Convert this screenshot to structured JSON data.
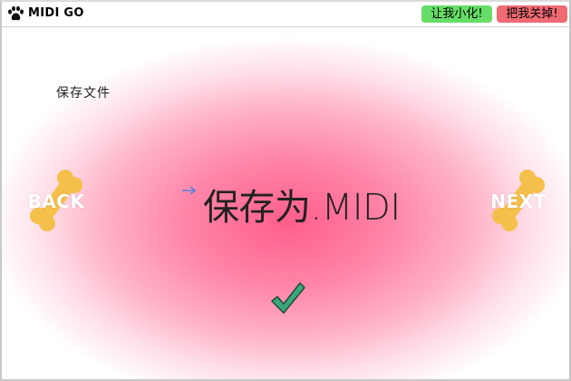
{
  "window": {
    "title": "MIDI GO",
    "minimize_label": "让我小化!",
    "close_label": "把我关掉!"
  },
  "content": {
    "section_label": "保存文件",
    "main_text": "保存为.MIDI",
    "back_label": "BACK",
    "next_label": "NEXT"
  },
  "icons": {
    "app": "paw-icon",
    "arrow": "arrow-right-icon",
    "confirm": "checkmark-icon",
    "nav_background": "bone-icon"
  },
  "colors": {
    "minimize_button": "#66dd66",
    "close_button": "#f06a74",
    "background_center": "#ff5e8a",
    "bone": "#f5c04a",
    "checkmark": "#3aa878",
    "arrow": "#4a7fe0"
  }
}
